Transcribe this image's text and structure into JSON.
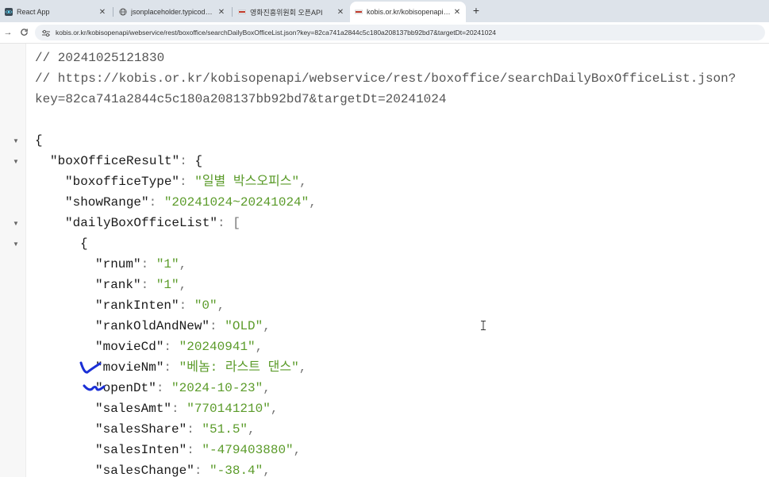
{
  "tabs": [
    {
      "title": "React App",
      "active": false
    },
    {
      "title": "jsonplaceholder.typicode.com",
      "active": false
    },
    {
      "title": "영화진흥위원회 오픈API",
      "active": false
    },
    {
      "title": "kobis.or.kr/kobisopenapi/webse",
      "active": true
    }
  ],
  "new_tab_symbol": "+",
  "address": {
    "url": "kobis.or.kr/kobisopenapi/webservice/rest/boxoffice/searchDailyBoxOfficeList.json?key=82ca741a2844c5c180a208137bb92bd7&targetDt=20241024"
  },
  "json_view": {
    "comment_timestamp": "// 20241025121830",
    "comment_url_1": "// https://kobis.or.kr/kobisopenapi/webservice/rest/boxoffice/searchDailyBoxOfficeList.json?",
    "comment_url_2": "key=82ca741a2844c5c180a208137bb92bd7&targetDt=20241024",
    "root_open": "{",
    "boxOfficeResult_key": "\"boxOfficeResult\"",
    "boxofficeType_key": "\"boxofficeType\"",
    "boxofficeType_val": "\"일별 박스오피스\"",
    "showRange_key": "\"showRange\"",
    "showRange_val": "\"20241024~20241024\"",
    "dailyBoxOfficeList_key": "\"dailyBoxOfficeList\"",
    "item_open": "{",
    "fields": [
      {
        "key": "\"rnum\"",
        "val": "\"1\""
      },
      {
        "key": "\"rank\"",
        "val": "\"1\""
      },
      {
        "key": "\"rankInten\"",
        "val": "\"0\""
      },
      {
        "key": "\"rankOldAndNew\"",
        "val": "\"OLD\""
      },
      {
        "key": "\"movieCd\"",
        "val": "\"20240941\""
      },
      {
        "key": "\"movieNm\"",
        "val": "\"베놈: 라스트 댄스\""
      },
      {
        "key": "\"openDt\"",
        "val": "\"2024-10-23\""
      },
      {
        "key": "\"salesAmt\"",
        "val": "\"770141210\""
      },
      {
        "key": "\"salesShare\"",
        "val": "\"51.5\""
      },
      {
        "key": "\"salesInten\"",
        "val": "\"-479403880\""
      },
      {
        "key": "\"salesChange\"",
        "val": "\"-38.4\""
      }
    ]
  },
  "colors": {
    "string": "#5b9b2a",
    "key": "#1a1a1a",
    "comment": "#555555",
    "annotation": "#1a2fd6"
  }
}
